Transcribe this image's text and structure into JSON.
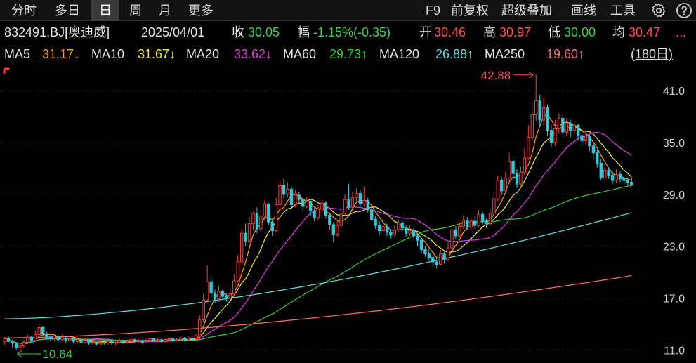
{
  "toolbar": {
    "tabs": [
      "分时",
      "多日",
      "日",
      "周",
      "月",
      "更多"
    ],
    "active_tab": "日",
    "tools": [
      "F9",
      "前复权",
      "超级叠加",
      "画线",
      "工具"
    ],
    "icons": [
      "gear-icon",
      "help-icon"
    ]
  },
  "quote": {
    "code": "832491.BJ[奥迪威]",
    "date": "2025/04/01",
    "close_label": "收",
    "close": "30.05",
    "change_label": "幅",
    "change": "-1.15%(-0.35)",
    "open_label": "开",
    "open": "30.46",
    "high_label": "高",
    "high": "30.97",
    "low_label": "低",
    "low": "30.00",
    "avg_label": "均",
    "avg": "30.47",
    "more": "..."
  },
  "ma_bar": {
    "items": [
      {
        "label": "MA5",
        "value": "31.17↓",
        "color": "#ff9a1f"
      },
      {
        "label": "MA10",
        "value": "31.67↓",
        "color": "#f2e83a"
      },
      {
        "label": "MA20",
        "value": "33.62↓",
        "color": "#e23ee2"
      },
      {
        "label": "MA60",
        "value": "29.73↑",
        "color": "#37c837"
      },
      {
        "label": "MA120",
        "value": "26.88↑",
        "color": "#5fe0e6"
      },
      {
        "label": "MA250",
        "value": "19.60↑",
        "color": "#ff6f6f"
      }
    ],
    "range_button": "(180日)"
  },
  "colors": {
    "up": "#ff3b3b",
    "down": "#35c6d8",
    "background": "#000000",
    "grid": "#2b2b2b"
  },
  "chart_data": {
    "type": "candlestick",
    "ylim": [
      9.5,
      44
    ],
    "yticks": [
      11.0,
      17.0,
      23.0,
      29.0,
      35.0,
      41.0
    ],
    "ytick_labels": [
      "11.0",
      "17.0",
      "23.0",
      "29.0",
      "35.0",
      "41.0"
    ],
    "annotations": {
      "max_label": "42.88",
      "min_label": "10.64"
    },
    "period_days": 180,
    "candles": [
      [
        12.0,
        12.3,
        12.5,
        11.6
      ],
      [
        12.3,
        12.0,
        12.6,
        11.9
      ],
      [
        12.0,
        11.8,
        12.2,
        11.3
      ],
      [
        11.8,
        11.3,
        11.9,
        11.0
      ],
      [
        11.3,
        11.5,
        11.8,
        10.64
      ],
      [
        11.5,
        11.9,
        12.2,
        11.3
      ],
      [
        11.9,
        12.5,
        12.8,
        11.7
      ],
      [
        12.5,
        12.1,
        12.6,
        11.8
      ],
      [
        12.1,
        12.8,
        13.2,
        12.0
      ],
      [
        12.8,
        13.6,
        14.2,
        12.6
      ],
      [
        13.6,
        12.9,
        13.8,
        12.6
      ],
      [
        12.9,
        12.5,
        13.1,
        12.2
      ],
      [
        12.5,
        12.3,
        12.7,
        12.0
      ],
      [
        12.3,
        12.6,
        12.9,
        12.1
      ],
      [
        12.6,
        12.2,
        12.7,
        11.9
      ],
      [
        12.2,
        12.4,
        12.8,
        12.1
      ],
      [
        12.4,
        12.1,
        12.5,
        11.8
      ],
      [
        12.1,
        12.3,
        12.6,
        11.9
      ],
      [
        12.3,
        12.0,
        12.4,
        11.7
      ],
      [
        12.0,
        12.2,
        12.5,
        11.8
      ],
      [
        12.2,
        11.9,
        12.3,
        11.7
      ],
      [
        11.9,
        12.1,
        12.4,
        11.8
      ],
      [
        12.1,
        11.8,
        12.2,
        11.6
      ],
      [
        11.8,
        11.9,
        12.1,
        11.6
      ],
      [
        11.9,
        11.7,
        12.0,
        11.5
      ],
      [
        11.7,
        11.9,
        12.1,
        11.5
      ],
      [
        11.9,
        11.8,
        12.1,
        11.6
      ],
      [
        11.8,
        12.0,
        12.2,
        11.6
      ],
      [
        12.0,
        11.8,
        12.1,
        11.6
      ],
      [
        11.8,
        11.9,
        12.1,
        11.6
      ],
      [
        11.9,
        12.1,
        12.4,
        11.8
      ],
      [
        12.1,
        11.9,
        12.2,
        11.7
      ],
      [
        11.9,
        12.0,
        12.2,
        11.7
      ],
      [
        12.0,
        12.2,
        12.5,
        11.9
      ],
      [
        12.2,
        12.0,
        12.3,
        11.8
      ],
      [
        12.0,
        12.1,
        12.3,
        11.8
      ],
      [
        12.1,
        11.9,
        12.2,
        11.7
      ],
      [
        12.0,
        12.1,
        12.3,
        11.8
      ],
      [
        12.1,
        12.3,
        12.6,
        12.0
      ],
      [
        12.3,
        12.1,
        12.4,
        11.9
      ],
      [
        12.1,
        12.2,
        12.4,
        11.9
      ],
      [
        12.2,
        12.0,
        12.3,
        11.8
      ],
      [
        12.0,
        12.2,
        12.4,
        11.9
      ],
      [
        12.2,
        12.3,
        12.5,
        12.0
      ],
      [
        12.3,
        12.1,
        12.4,
        11.9
      ],
      [
        12.1,
        12.2,
        12.4,
        12.0
      ],
      [
        12.2,
        12.4,
        12.6,
        12.1
      ],
      [
        12.4,
        12.2,
        12.5,
        12.0
      ],
      [
        12.2,
        12.4,
        12.6,
        12.1
      ],
      [
        12.4,
        12.3,
        12.6,
        12.1
      ],
      [
        12.3,
        12.6,
        12.9,
        12.2
      ],
      [
        12.6,
        14.5,
        15.0,
        12.5
      ],
      [
        14.5,
        16.8,
        17.5,
        14.2
      ],
      [
        16.8,
        18.9,
        20.8,
        16.5
      ],
      [
        18.9,
        17.6,
        19.4,
        17.0
      ],
      [
        17.6,
        16.9,
        18.0,
        16.4
      ],
      [
        16.9,
        17.8,
        18.4,
        16.6
      ],
      [
        17.8,
        17.2,
        18.1,
        16.8
      ],
      [
        17.2,
        17.0,
        17.6,
        16.6
      ],
      [
        17.0,
        17.5,
        18.0,
        16.8
      ],
      [
        17.5,
        19.0,
        19.8,
        17.3
      ],
      [
        19.0,
        21.2,
        22.0,
        18.8
      ],
      [
        21.2,
        24.5,
        25.0,
        21.0
      ],
      [
        24.5,
        23.6,
        25.6,
        23.0
      ],
      [
        23.6,
        25.6,
        26.4,
        23.3
      ],
      [
        25.6,
        26.8,
        27.0,
        24.8
      ],
      [
        26.8,
        25.0,
        27.5,
        24.5
      ],
      [
        25.0,
        26.5,
        27.2,
        24.6
      ],
      [
        26.5,
        27.9,
        28.3,
        26.0
      ],
      [
        27.9,
        25.8,
        28.0,
        25.5
      ],
      [
        25.8,
        24.8,
        26.2,
        24.2
      ],
      [
        24.8,
        27.8,
        28.6,
        24.6
      ],
      [
        27.8,
        30.0,
        30.5,
        27.5
      ],
      [
        30.0,
        29.0,
        30.8,
        28.5
      ],
      [
        29.0,
        29.6,
        30.4,
        28.7
      ],
      [
        29.6,
        27.8,
        29.9,
        27.5
      ],
      [
        27.8,
        28.9,
        29.5,
        27.5
      ],
      [
        28.9,
        28.4,
        29.3,
        27.9
      ],
      [
        28.4,
        27.6,
        28.7,
        27.0
      ],
      [
        27.6,
        28.2,
        28.7,
        27.4
      ],
      [
        28.2,
        27.1,
        28.3,
        26.5
      ],
      [
        27.1,
        26.3,
        27.4,
        25.9
      ],
      [
        26.3,
        27.3,
        27.8,
        26.0
      ],
      [
        27.3,
        28.0,
        28.4,
        26.9
      ],
      [
        28.0,
        26.6,
        28.2,
        26.2
      ],
      [
        26.6,
        25.5,
        26.9,
        24.9
      ],
      [
        25.5,
        24.4,
        25.8,
        23.5
      ],
      [
        24.4,
        25.4,
        25.9,
        24.1
      ],
      [
        25.4,
        26.8,
        27.2,
        25.1
      ],
      [
        26.8,
        28.4,
        29.0,
        26.5
      ],
      [
        28.4,
        27.5,
        30.2,
        27.2
      ],
      [
        27.5,
        28.6,
        29.3,
        27.1
      ],
      [
        28.6,
        29.1,
        29.7,
        28.2
      ],
      [
        29.1,
        27.9,
        29.5,
        27.5
      ],
      [
        27.9,
        28.3,
        29.9,
        27.6
      ],
      [
        28.3,
        27.2,
        28.6,
        26.8
      ],
      [
        27.2,
        26.1,
        27.5,
        25.8
      ],
      [
        26.1,
        25.4,
        26.5,
        25.0
      ],
      [
        25.4,
        24.8,
        25.9,
        24.3
      ],
      [
        24.8,
        25.3,
        25.8,
        24.5
      ],
      [
        25.3,
        24.6,
        25.6,
        24.2
      ],
      [
        24.6,
        24.3,
        25.0,
        23.9
      ],
      [
        24.3,
        24.9,
        25.4,
        24.0
      ],
      [
        24.9,
        25.7,
        26.1,
        24.6
      ],
      [
        25.7,
        25.1,
        26.0,
        24.7
      ],
      [
        25.1,
        24.5,
        25.4,
        24.1
      ],
      [
        24.5,
        24.8,
        25.4,
        24.2
      ],
      [
        24.8,
        24.2,
        25.1,
        23.9
      ],
      [
        24.2,
        23.7,
        24.5,
        23.0
      ],
      [
        23.7,
        22.6,
        24.0,
        22.2
      ],
      [
        22.6,
        22.1,
        23.0,
        21.8
      ],
      [
        22.1,
        21.7,
        22.6,
        21.3
      ],
      [
        21.7,
        21.2,
        22.0,
        20.6
      ],
      [
        21.2,
        20.9,
        21.8,
        20.4
      ],
      [
        20.9,
        22.1,
        22.6,
        20.8
      ],
      [
        22.1,
        21.5,
        22.4,
        21.0
      ],
      [
        21.5,
        22.8,
        23.5,
        21.3
      ],
      [
        22.8,
        24.9,
        25.5,
        22.6
      ],
      [
        24.9,
        24.2,
        25.3,
        23.8
      ],
      [
        24.2,
        25.3,
        25.8,
        24.0
      ],
      [
        25.3,
        26.0,
        26.6,
        25.0
      ],
      [
        26.0,
        25.2,
        26.4,
        24.8
      ],
      [
        25.2,
        25.9,
        26.3,
        24.9
      ],
      [
        25.9,
        25.4,
        26.5,
        25.0
      ],
      [
        25.4,
        26.7,
        27.2,
        25.2
      ],
      [
        26.7,
        25.9,
        27.0,
        25.5
      ],
      [
        25.9,
        25.6,
        26.2,
        25.1
      ],
      [
        25.6,
        26.8,
        27.3,
        25.4
      ],
      [
        26.8,
        28.5,
        29.3,
        26.6
      ],
      [
        28.5,
        30.6,
        31.2,
        28.2
      ],
      [
        30.6,
        29.4,
        31.0,
        28.9
      ],
      [
        29.4,
        30.9,
        31.6,
        29.0
      ],
      [
        30.9,
        32.8,
        33.8,
        30.5
      ],
      [
        32.8,
        31.4,
        33.0,
        30.8
      ],
      [
        31.4,
        30.2,
        31.9,
        29.7
      ],
      [
        30.2,
        31.5,
        32.2,
        30.0
      ],
      [
        31.5,
        33.2,
        34.4,
        31.2
      ],
      [
        33.2,
        35.6,
        37.0,
        33.0
      ],
      [
        35.6,
        38.2,
        39.5,
        35.0
      ],
      [
        38.2,
        39.8,
        42.88,
        37.5
      ],
      [
        39.8,
        37.6,
        40.5,
        36.8
      ],
      [
        37.6,
        39.0,
        40.2,
        36.9
      ],
      [
        39.0,
        36.4,
        39.4,
        35.8
      ],
      [
        36.4,
        35.0,
        37.0,
        34.4
      ],
      [
        35.0,
        36.6,
        37.6,
        34.6
      ],
      [
        36.6,
        37.8,
        38.4,
        36.0
      ],
      [
        37.8,
        36.2,
        38.2,
        35.6
      ],
      [
        36.2,
        37.2,
        37.8,
        35.7
      ],
      [
        37.2,
        36.4,
        37.6,
        35.6
      ],
      [
        36.4,
        37.0,
        37.5,
        35.8
      ],
      [
        37.0,
        35.8,
        37.2,
        35.2
      ],
      [
        35.8,
        35.2,
        36.1,
        34.6
      ],
      [
        35.2,
        35.7,
        36.3,
        34.8
      ],
      [
        35.7,
        34.6,
        36.0,
        34.0
      ],
      [
        34.6,
        33.8,
        34.9,
        33.0
      ],
      [
        33.8,
        32.6,
        34.2,
        32.1
      ],
      [
        32.6,
        30.9,
        33.1,
        30.6
      ],
      [
        30.9,
        31.8,
        32.4,
        30.6
      ],
      [
        31.8,
        31.2,
        32.1,
        30.8
      ],
      [
        31.2,
        30.6,
        31.6,
        30.2
      ],
      [
        30.6,
        31.3,
        31.9,
        30.3
      ],
      [
        31.3,
        30.8,
        31.7,
        30.4
      ],
      [
        30.8,
        30.6,
        31.2,
        30.2
      ],
      [
        30.6,
        30.4,
        30.97,
        30.0
      ],
      [
        30.4,
        30.05,
        30.97,
        30.0
      ]
    ],
    "series": [
      {
        "name": "MA5",
        "color": "#ff9a1f",
        "period": 5
      },
      {
        "name": "MA10",
        "color": "#f2e83a",
        "period": 10
      },
      {
        "name": "MA20",
        "color": "#e23ee2",
        "period": 20
      },
      {
        "name": "MA60",
        "color": "#37c837",
        "period": 60
      },
      {
        "name": "MA120",
        "color": "#5fe0e6",
        "period": 120
      },
      {
        "name": "MA250",
        "color": "#ff6f6f",
        "period": 250
      }
    ],
    "long_ma_anchor_values": {
      "MA120": {
        "start": 14.6,
        "end": 26.88
      },
      "MA250": {
        "start": 12.4,
        "end": 19.6
      }
    }
  }
}
